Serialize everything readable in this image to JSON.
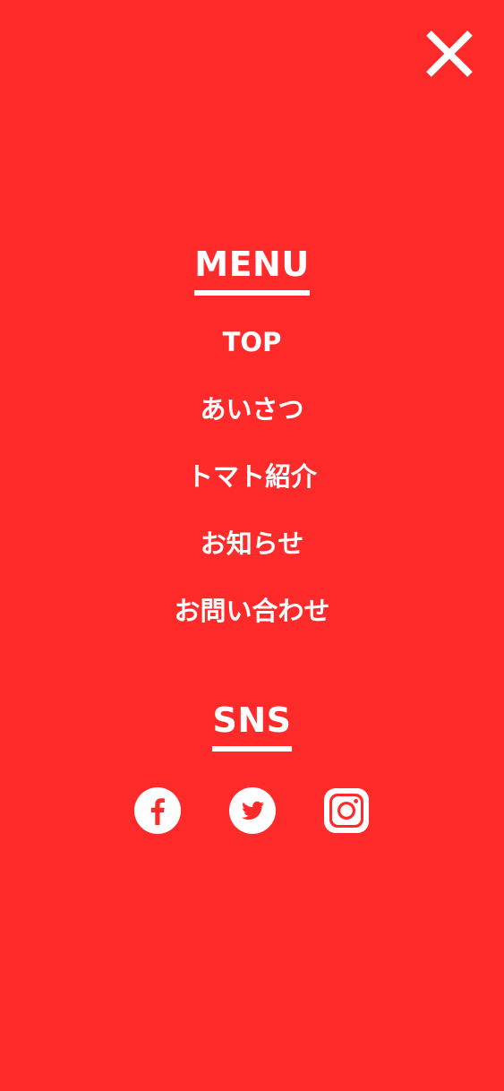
{
  "colors": {
    "background": "#ff2a2a",
    "foreground": "#ffffff"
  },
  "menu": {
    "heading": "MENU",
    "items": [
      {
        "label": "TOP"
      },
      {
        "label": "あいさつ"
      },
      {
        "label": "トマト紹介"
      },
      {
        "label": "お知らせ"
      },
      {
        "label": "お問い合わせ"
      }
    ]
  },
  "sns": {
    "heading": "SNS",
    "icons": [
      "facebook-icon",
      "twitter-icon",
      "instagram-icon"
    ]
  },
  "close_icon": "close-icon"
}
